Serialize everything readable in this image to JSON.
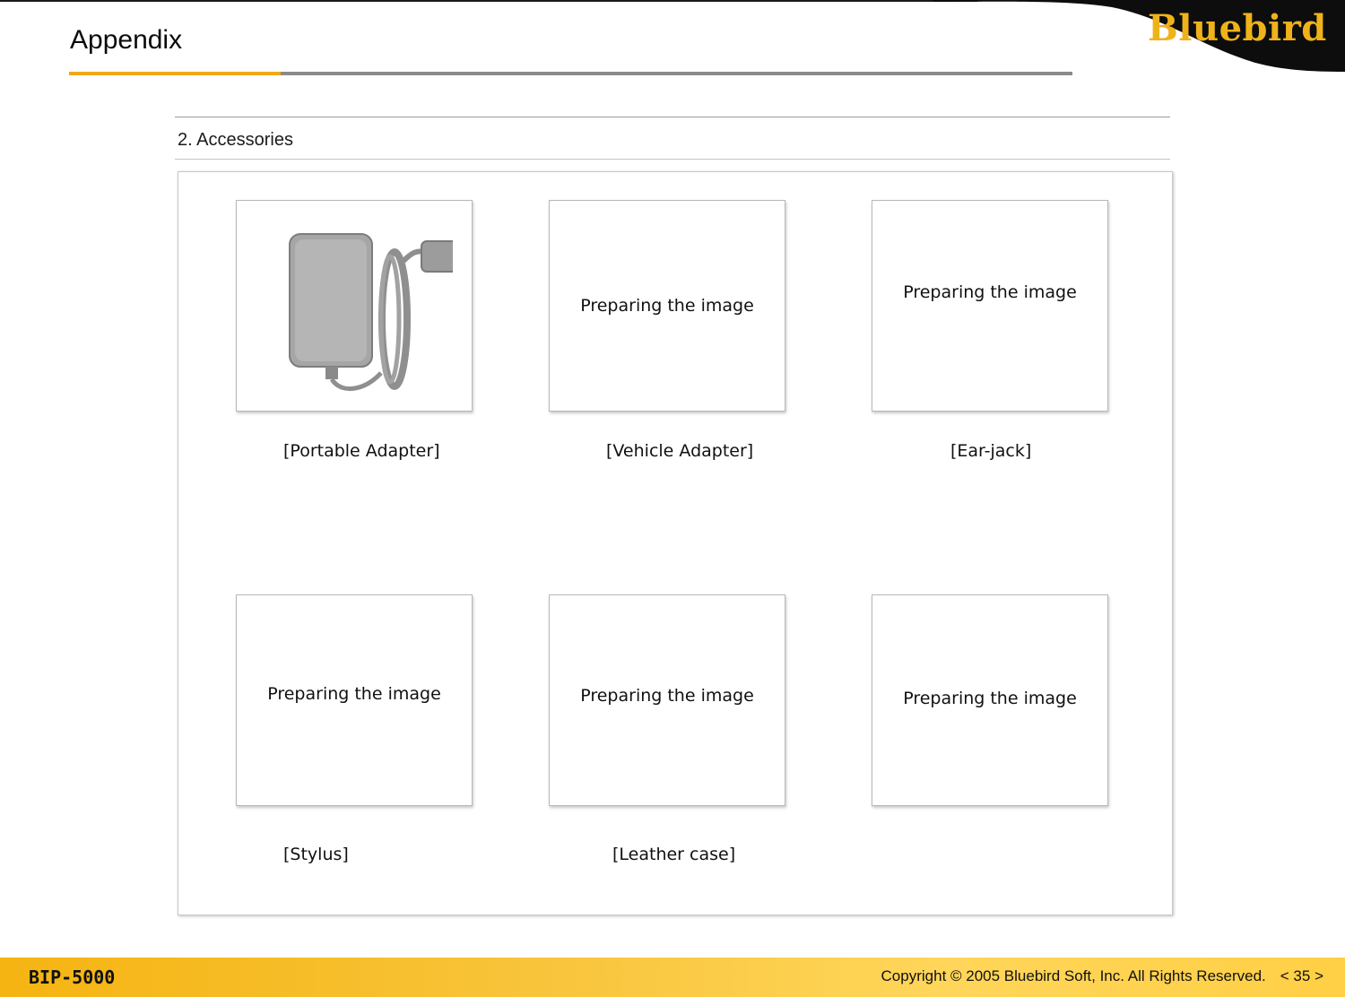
{
  "header": {
    "title": "Appendix",
    "brand": "Bluebird"
  },
  "section": {
    "title": "2. Accessories"
  },
  "items": [
    {
      "caption": "[Portable Adapter]",
      "placeholder": "",
      "icon": "portable-adapter-image"
    },
    {
      "caption": "[Vehicle Adapter]",
      "placeholder": "Preparing the image"
    },
    {
      "caption": "[Ear-jack]",
      "placeholder": "Preparing the image"
    },
    {
      "caption": "[Stylus]",
      "placeholder": "Preparing the image"
    },
    {
      "caption": "[Leather case]",
      "placeholder": "Preparing the image"
    },
    {
      "caption": "",
      "placeholder": "Preparing the image"
    }
  ],
  "footer": {
    "model": "BIP-5000",
    "copyright": "Copyright © 2005 Bluebird Soft, Inc. All Rights Reserved.",
    "page": "< 35 >"
  },
  "colors": {
    "accent": "#f0a81a",
    "footer": "#f8c43a"
  }
}
